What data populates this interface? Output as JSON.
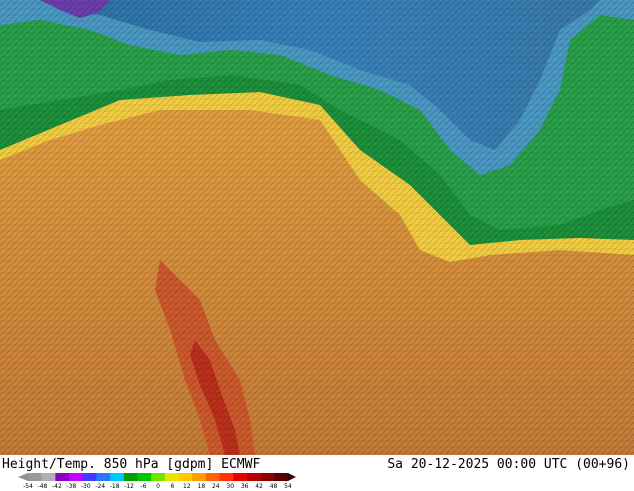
{
  "title": "Height/Temp. 850 hPa [gdpm] ECMWF",
  "datetime": "Sa 20-12-2025 00:00 UTC (00+96)",
  "colorbar": {
    "ticks": [
      "-54",
      "-48",
      "-42",
      "-38",
      "-30",
      "-24",
      "-18",
      "-12",
      "-6",
      "0",
      "6",
      "12",
      "18",
      "24",
      "30",
      "36",
      "42",
      "48",
      "54"
    ],
    "colors": [
      "#9a9a9a",
      "#b0b0b0",
      "#8c00c8",
      "#c800ff",
      "#3c3cff",
      "#2878ff",
      "#00c8ff",
      "#00a000",
      "#00c800",
      "#6ee600",
      "#e6e600",
      "#ffc800",
      "#ffa000",
      "#ff6400",
      "#ff3200",
      "#e60000",
      "#b40000",
      "#8c0000",
      "#5a0000"
    ]
  },
  "map": {
    "regions": [
      {
        "name": "cold-north",
        "color": "#3a6ea8"
      },
      {
        "name": "polar-blue",
        "color": "#4aa0c8"
      },
      {
        "name": "green-band",
        "color": "#1e8c3a"
      },
      {
        "name": "yellow-band",
        "color": "#f0d24a"
      },
      {
        "name": "warm-south",
        "color": "#c8843c"
      },
      {
        "name": "hot-core",
        "color": "#c85028"
      }
    ]
  }
}
